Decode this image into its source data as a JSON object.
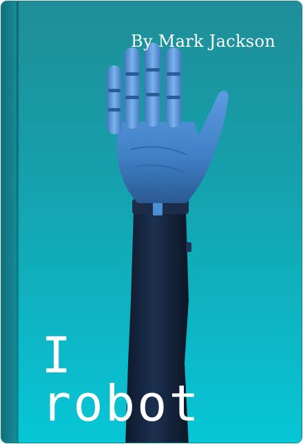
{
  "book": {
    "author": "By Mark Jackson",
    "title_line_1": "I",
    "title_line_2": "robot"
  },
  "colors": {
    "cover_top": "#1f8e99",
    "cover_bottom": "#07c6d6",
    "spine": "#14808b",
    "text": "#ffffff",
    "arm_dark": "#142238",
    "hand_blue": "#3f7fc4"
  },
  "icons": {
    "cover_art": "robotic-arm-icon"
  }
}
